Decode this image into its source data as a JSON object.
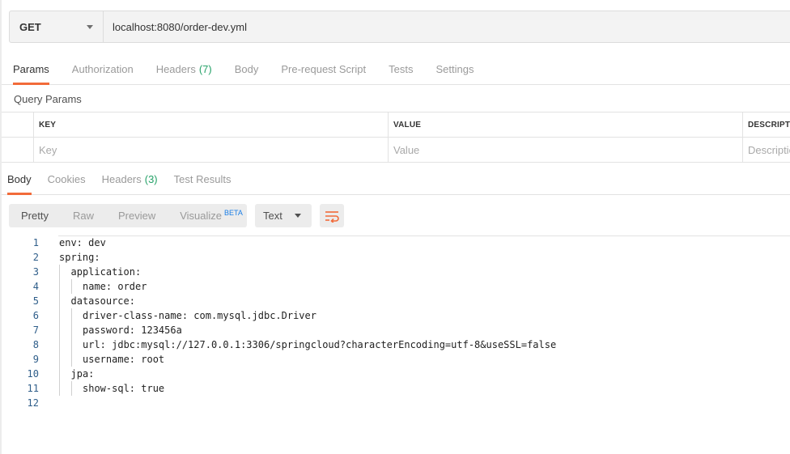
{
  "request": {
    "method": "GET",
    "url": "localhost:8080/order-dev.yml"
  },
  "request_tabs": [
    {
      "label": "Params",
      "count": "",
      "active": true
    },
    {
      "label": "Authorization",
      "count": "",
      "active": false
    },
    {
      "label": "Headers",
      "count": "(7)",
      "active": false
    },
    {
      "label": "Body",
      "count": "",
      "active": false
    },
    {
      "label": "Pre-request Script",
      "count": "",
      "active": false
    },
    {
      "label": "Tests",
      "count": "",
      "active": false
    },
    {
      "label": "Settings",
      "count": "",
      "active": false
    }
  ],
  "query_params": {
    "title": "Query Params",
    "headers": {
      "key": "KEY",
      "value": "VALUE",
      "description": "DESCRIPTION"
    },
    "placeholders": {
      "key": "Key",
      "value": "Value",
      "description": "Description"
    }
  },
  "response_tabs": [
    {
      "label": "Body",
      "count": "",
      "active": true
    },
    {
      "label": "Cookies",
      "count": "",
      "active": false
    },
    {
      "label": "Headers",
      "count": "(3)",
      "active": false
    },
    {
      "label": "Test Results",
      "count": "",
      "active": false
    }
  ],
  "view_modes": [
    {
      "label": "Pretty",
      "badge": "",
      "active": true
    },
    {
      "label": "Raw",
      "badge": "",
      "active": false
    },
    {
      "label": "Preview",
      "badge": "",
      "active": false
    },
    {
      "label": "Visualize",
      "badge": "BETA",
      "active": false
    }
  ],
  "format": {
    "selected": "Text"
  },
  "wrap_icon": "wrap-lines-icon",
  "colors": {
    "accent": "#f26b3a",
    "count": "#26a269",
    "beta": "#1a7ee6",
    "line_number": "#2f5e8a"
  },
  "code_lines": [
    {
      "n": "1",
      "indent": 0,
      "text": "env: dev"
    },
    {
      "n": "2",
      "indent": 0,
      "text": "spring:"
    },
    {
      "n": "3",
      "indent": 1,
      "text": "application:"
    },
    {
      "n": "4",
      "indent": 2,
      "text": "name: order"
    },
    {
      "n": "5",
      "indent": 1,
      "text": "datasource:"
    },
    {
      "n": "6",
      "indent": 2,
      "text": "driver-class-name: com.mysql.jdbc.Driver"
    },
    {
      "n": "7",
      "indent": 2,
      "text": "password: 123456a"
    },
    {
      "n": "8",
      "indent": 2,
      "text": "url: jdbc:mysql://127.0.0.1:3306/springcloud?characterEncoding=utf-8&useSSL=false"
    },
    {
      "n": "9",
      "indent": 2,
      "text": "username: root"
    },
    {
      "n": "10",
      "indent": 1,
      "text": "jpa:"
    },
    {
      "n": "11",
      "indent": 2,
      "text": "show-sql: true"
    },
    {
      "n": "12",
      "indent": 0,
      "text": ""
    }
  ]
}
